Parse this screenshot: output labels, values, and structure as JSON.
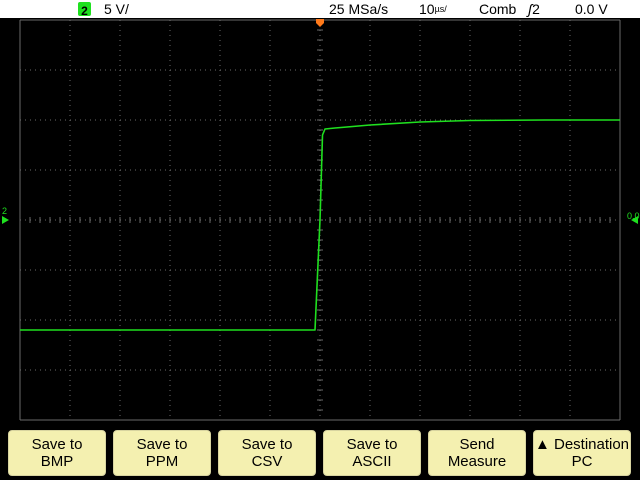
{
  "status": {
    "channel_badge": "2",
    "vertical_scale": "5 V/",
    "sample_rate": "25 MSa/s",
    "timebase_value": "10",
    "timebase_unit": "µs/",
    "acquisition_mode": "Comb",
    "trigger_source": "2",
    "trigger_level": "0.0 V"
  },
  "markers": {
    "channel_ground": "2",
    "trigger_level": "0.0"
  },
  "colors": {
    "trace": "#1fe01f",
    "grid": "#6a6a6a",
    "trigger_marker": "#ff7a1a",
    "softkey_bg": "#f4f0b0"
  },
  "chart_data": {
    "type": "line",
    "grid": {
      "x_divisions": 12,
      "y_divisions": 8
    },
    "x_unit_per_div": 10,
    "y_unit_per_div": 5,
    "series": [
      {
        "points": [
          [
            -60,
            -11
          ],
          [
            -30,
            -11
          ],
          [
            -1,
            -11
          ],
          [
            0,
            0
          ],
          [
            0.5,
            8.5
          ],
          [
            1,
            9.1
          ],
          [
            3,
            9.2
          ],
          [
            10,
            9.5
          ],
          [
            20,
            9.8
          ],
          [
            30,
            9.95
          ],
          [
            45,
            10.0
          ],
          [
            60,
            10.0
          ]
        ]
      }
    ]
  },
  "softkeys": [
    {
      "line1": "Save to",
      "line2": "BMP"
    },
    {
      "line1": "Save to",
      "line2": "PPM"
    },
    {
      "line1": "Save to",
      "line2": "CSV"
    },
    {
      "line1": "Save to",
      "line2": "ASCII"
    },
    {
      "line1": "Send",
      "line2": "Measure"
    },
    {
      "line1": "▲ Destination",
      "line2": "PC"
    }
  ]
}
